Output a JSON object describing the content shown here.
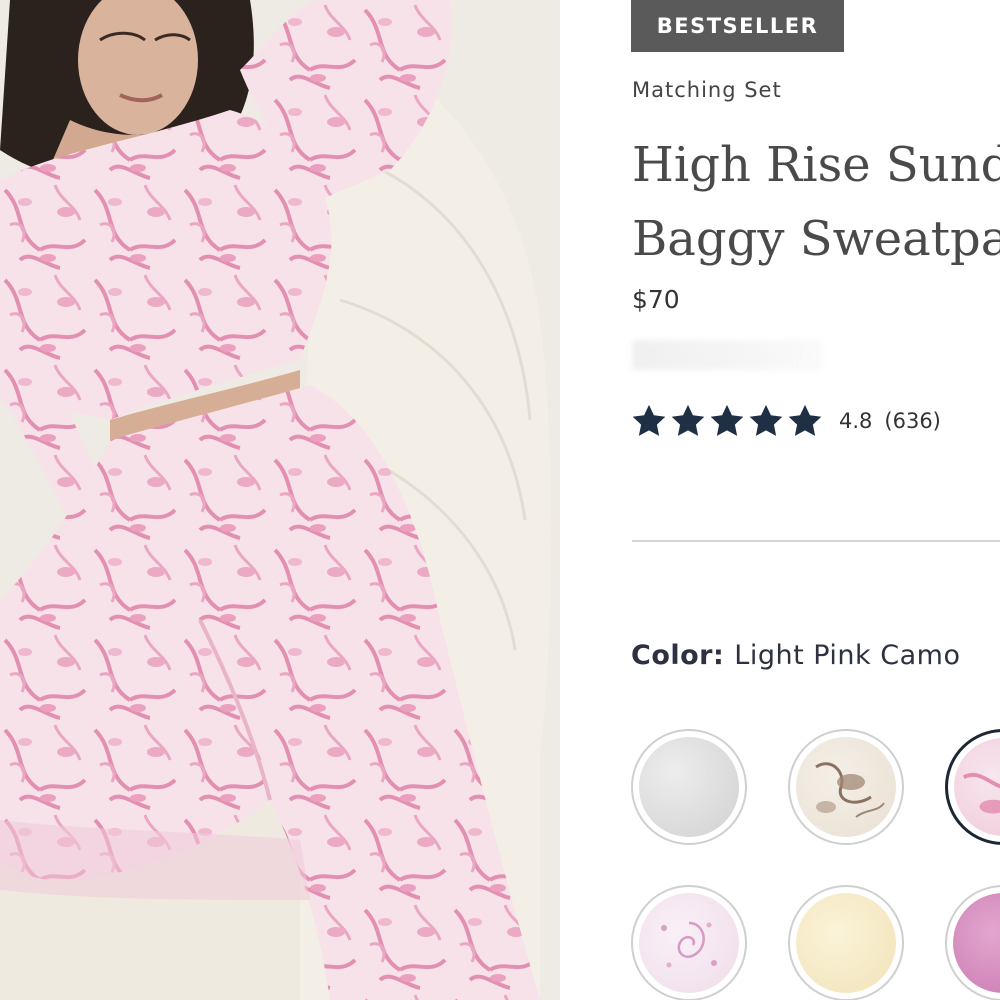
{
  "product": {
    "badge": "BESTSELLER",
    "collection": "Matching Set",
    "title_line1": "High Rise Sunday",
    "title_line2": "Baggy Sweatpants",
    "price": "$70",
    "rating": {
      "value": "4.8",
      "count": "(636)",
      "stars": 5
    },
    "color": {
      "label": "Color:",
      "value": "Light Pink Camo"
    }
  },
  "swatches": [
    {
      "name": "heather-grey",
      "selected": false
    },
    {
      "name": "floral-print",
      "selected": false
    },
    {
      "name": "light-pink-camo",
      "selected": true
    },
    {
      "name": "pink-paisley",
      "selected": false
    },
    {
      "name": "cream",
      "selected": false
    },
    {
      "name": "mauve",
      "selected": false
    }
  ],
  "colors": {
    "badge_bg": "#5a5a5a",
    "star": "#1f2f44",
    "selected_ring": "#1d2733",
    "pink_camo": "#e79bbb"
  },
  "icons": [
    "star-icon"
  ]
}
